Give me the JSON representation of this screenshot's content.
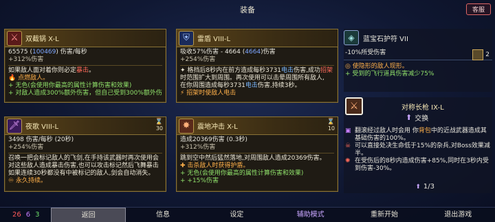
{
  "header": {
    "title": "装备",
    "support_label": "客服"
  },
  "cards": [
    {
      "name": "双截锅 X-L",
      "stat1_a": "65575 (",
      "stat1_b": "100469",
      "stat1_c": ") 伤害/每秒",
      "stat2": "+312%伤害",
      "desc_a": "如果敌人面对着你则必定",
      "desc_b": "暴击",
      "desc_c": "。",
      "fx1": "点燃敌人。",
      "fx2": "无色(会使用你最高的属性计算伤害和效果)",
      "fx3": "对敌人造成300%额外伤害，但自己受到300%额外伤",
      "icon": "crossed-swords-icon"
    },
    {
      "name": "雷盾 VIII-L",
      "stat1_a": "吸收57%伤害 - 4664 (",
      "stat1_b": "4664",
      "stat1_c": ")伤害",
      "stat2": "+254%伤害",
      "desc1_a": "格挡后8秒内在前方造成每秒3731",
      "desc1_b": "电击",
      "desc1_c": "伤害,成功",
      "desc1_d": "招架",
      "desc1_e": "时范围扩大到周围。再次使用可以击晕周围所有敌人,",
      "desc2_a": "在你周围造成每秒3731",
      "desc2_b": "电击",
      "desc2_c": "伤害,持续3秒。",
      "fx1": "招架时使敌人电击",
      "icon": "shield-icon"
    },
    {
      "name": "夜歌 VIII-L",
      "cooldown": "30",
      "stat1": "3498 伤害/每秒 (20秒)",
      "stat2": "+254%伤害",
      "desc1": "召唤一把会标记敌人的飞剑,在手持该武器时再次使用会",
      "desc2": "对这些敌人造成暴击伤害,也可以攻击标记然后飞舞暴击",
      "desc3": "如果连续30秒都没有中被标记的敌人,剑会自动消失。",
      "fx1": "永久持续。",
      "icon": "sword-icon"
    },
    {
      "name": "震地冲击 X-L",
      "cooldown": "10",
      "stat1": "造成20369伤害 (0.3秒)",
      "stat2": "+312%伤害",
      "desc": "跳到空中然后猛然落地,对周围敌人造成20369伤害。",
      "fx1": "击杀敌人时获得护盾。",
      "fx2": "无色(会使用你最高的属性计算伤害和效果)",
      "fx3": "+15%伤害",
      "icon": "slam-icon"
    }
  ],
  "amulet": {
    "name": "蓝宝石护符 VII",
    "line1": "-10%所受伤害",
    "line2": "使隐形的敌人现形。",
    "line3": "受到的飞行道具伤害减少75%",
    "scroll_count": "2"
  },
  "swap_item": {
    "name": "对称长枪 IX-L",
    "swap_label": "交换",
    "line1_a": "翻滚经过敌人时会用 你",
    "line1_b": "背包",
    "line1_c": "中的近战武器造成其基础伤害的100%。",
    "line2": "可以直接处决生命低于15%的杂兵,对Boss效果减半。",
    "line3": "在受伤后的8秒内造成伤害+85%,同时在3秒内受到伤害-30%。",
    "page": "1/3"
  },
  "bottom": {
    "count_red": "26",
    "count_purple": "6",
    "count_green": "3",
    "back": "返回",
    "info": "信息",
    "settings": "设定",
    "assist": "辅助模式",
    "restart": "重新开始",
    "quit": "退出游戏"
  },
  "colors": {
    "frame_gold": "#8a7336",
    "accent_red": "#ff6a5a",
    "accent_blue": "#7da6ff",
    "accent_green": "#8fe06a"
  }
}
